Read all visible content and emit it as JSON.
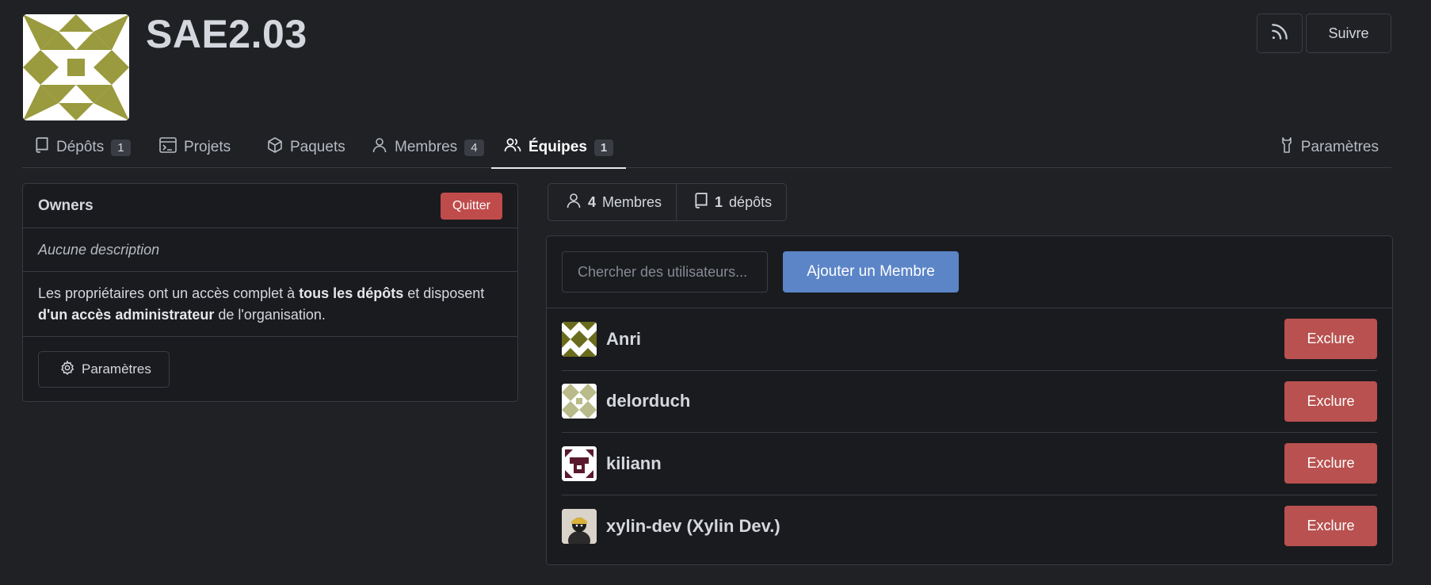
{
  "org": {
    "name": "SAE2.03"
  },
  "header": {
    "rss_icon": "rss-icon",
    "follow_label": "Suivre"
  },
  "tabs": [
    {
      "label": "Dépôts",
      "icon": "repo-icon",
      "count": "1"
    },
    {
      "label": "Projets",
      "icon": "project-icon",
      "count": null
    },
    {
      "label": "Paquets",
      "icon": "package-icon",
      "count": null
    },
    {
      "label": "Membres",
      "icon": "person-icon",
      "count": "4"
    },
    {
      "label": "Équipes",
      "icon": "people-icon",
      "count": "1",
      "active": true
    }
  ],
  "settings_tab": {
    "label": "Paramètres",
    "icon": "tools-icon"
  },
  "team": {
    "name": "Owners",
    "quit_label": "Quitter",
    "description": "Aucune description",
    "perm_1": "Les propriétaires ont un accès complet à ",
    "perm_2": "tous les dépôts",
    "perm_3": " et disposent ",
    "perm_4": "d'un accès administrateur",
    "perm_5": " de l'organisation.",
    "settings_label": "Paramètres"
  },
  "stats": {
    "members_count": "4",
    "members_label": "Membres",
    "repos_count": "1",
    "repos_label": "dépôts"
  },
  "add_member": {
    "placeholder": "Chercher des utilisateurs...",
    "button_label": "Ajouter un Membre"
  },
  "members": [
    {
      "name": "Anri",
      "kick_label": "Exclure"
    },
    {
      "name": "delorduch",
      "kick_label": "Exclure"
    },
    {
      "name": "kiliann",
      "kick_label": "Exclure"
    },
    {
      "name": "xylin-dev (Xylin Dev.)",
      "kick_label": "Exclure"
    }
  ],
  "colors": {
    "background": "#1f2125",
    "danger": "#b8514f",
    "primary": "#5b85c7",
    "avatar_olive": "#9a9a3e"
  }
}
